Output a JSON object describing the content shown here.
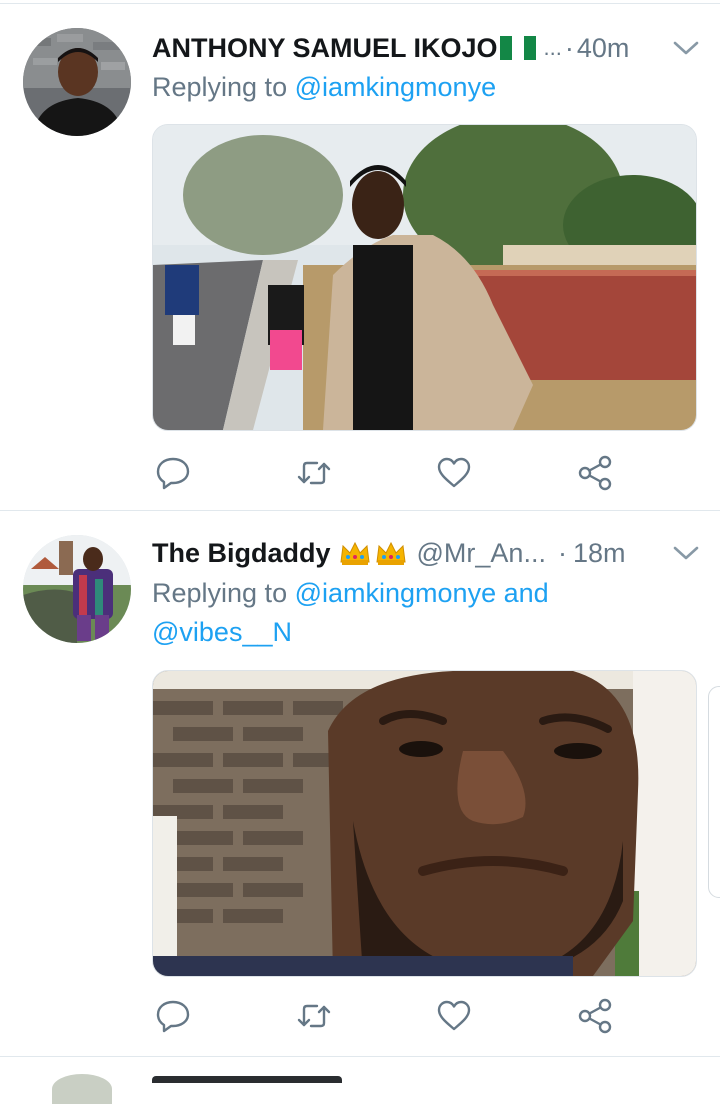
{
  "colors": {
    "accent": "#1da1f2",
    "muted": "#657786",
    "text": "#14171a",
    "divider": "#e1e8ed"
  },
  "tweets": [
    {
      "name": "ANTHONY SAMUEL IKOJO",
      "flag": "nigeria-flag-emoji",
      "handle": "...",
      "separator": "·",
      "time": "40m",
      "replying_prefix": "Replying to",
      "replying_to": [
        "@iamkingmonye"
      ],
      "replying_join": "",
      "actions": [
        "reply-icon",
        "retweet-icon",
        "like-icon",
        "share-icon"
      ]
    },
    {
      "name": "The Bigdaddy",
      "badges": "crown-emoji crown-emoji",
      "handle": "@Mr_An...",
      "separator": "·",
      "time": "18m",
      "replying_prefix": "Replying to",
      "replying_to": [
        "@iamkingmonye",
        "@vibes__N"
      ],
      "replying_join": "and",
      "actions": [
        "reply-icon",
        "retweet-icon",
        "like-icon",
        "share-icon"
      ]
    }
  ]
}
